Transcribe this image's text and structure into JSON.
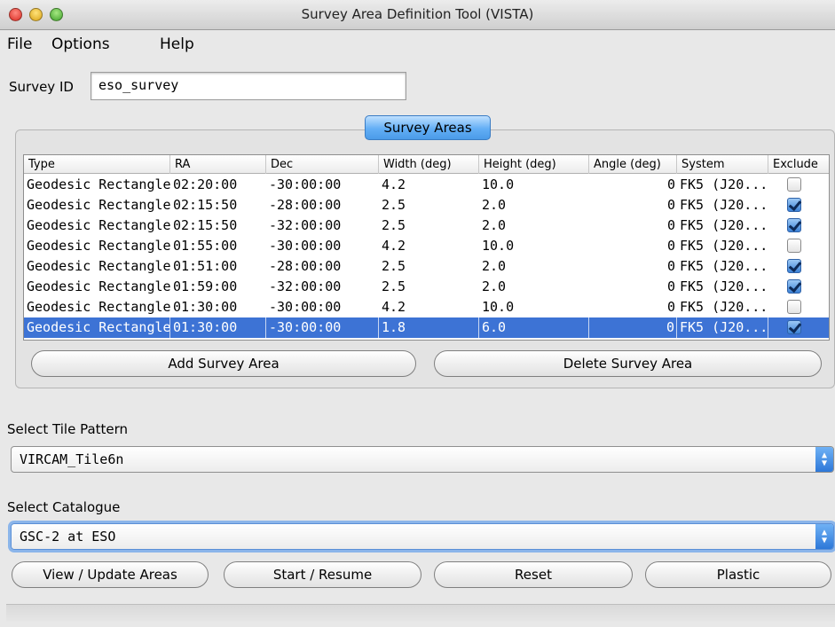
{
  "window": {
    "title": "Survey Area Definition Tool (VISTA)"
  },
  "menu": {
    "file": "File",
    "options": "Options",
    "help": "Help"
  },
  "survey_id": {
    "label": "Survey ID",
    "value": "eso_survey"
  },
  "survey_areas": {
    "tab_label": "Survey Areas",
    "columns": [
      "Type",
      "RA",
      "Dec",
      "Width (deg)",
      "Height (deg)",
      "Angle (deg)",
      "System",
      "Exclude"
    ],
    "rows": [
      {
        "type": "Geodesic Rectangle",
        "ra": "02:20:00",
        "dec": "-30:00:00",
        "width": "4.2",
        "height": "10.0",
        "angle": "0",
        "system": "FK5 (J20...",
        "exclude": false
      },
      {
        "type": "Geodesic Rectangle",
        "ra": "02:15:50",
        "dec": "-28:00:00",
        "width": "2.5",
        "height": "2.0",
        "angle": "0",
        "system": "FK5 (J20...",
        "exclude": true
      },
      {
        "type": "Geodesic Rectangle",
        "ra": "02:15:50",
        "dec": "-32:00:00",
        "width": "2.5",
        "height": "2.0",
        "angle": "0",
        "system": "FK5 (J20...",
        "exclude": true
      },
      {
        "type": "Geodesic Rectangle",
        "ra": "01:55:00",
        "dec": "-30:00:00",
        "width": "4.2",
        "height": "10.0",
        "angle": "0",
        "system": "FK5 (J20...",
        "exclude": false
      },
      {
        "type": "Geodesic Rectangle",
        "ra": "01:51:00",
        "dec": "-28:00:00",
        "width": "2.5",
        "height": "2.0",
        "angle": "0",
        "system": "FK5 (J20...",
        "exclude": true
      },
      {
        "type": "Geodesic Rectangle",
        "ra": "01:59:00",
        "dec": "-32:00:00",
        "width": "2.5",
        "height": "2.0",
        "angle": "0",
        "system": "FK5 (J20...",
        "exclude": true
      },
      {
        "type": "Geodesic Rectangle",
        "ra": "01:30:00",
        "dec": "-30:00:00",
        "width": "4.2",
        "height": "10.0",
        "angle": "0",
        "system": "FK5 (J20...",
        "exclude": false
      },
      {
        "type": "Geodesic Rectangle",
        "ra": "01:30:00",
        "dec": "-30:00:00",
        "width": "1.8",
        "height": "6.0",
        "angle": "0",
        "system": "FK5 (J20...",
        "exclude": true,
        "selected": true
      }
    ],
    "add_label": "Add Survey Area",
    "delete_label": "Delete Survey Area"
  },
  "tile_pattern": {
    "label": "Select Tile Pattern",
    "value": "VIRCAM_Tile6n"
  },
  "catalogue": {
    "label": "Select Catalogue",
    "value": "GSC-2 at ESO"
  },
  "actions": {
    "view_update": "View / Update Areas",
    "start_resume": "Start / Resume",
    "reset": "Reset",
    "plastic": "Plastic"
  },
  "colors": {
    "selection": "#3d73d5",
    "tab_accent": "#62aef5"
  }
}
